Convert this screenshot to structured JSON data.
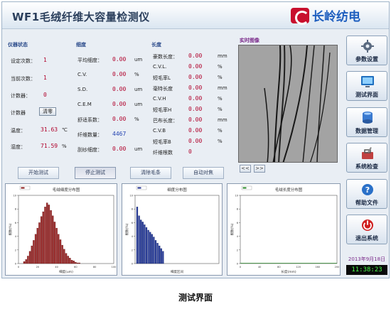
{
  "header": {
    "title": "WF1毛绒纤维大容量检测仪",
    "brand": "长岭纺电"
  },
  "status": {
    "title": "仪器状态",
    "rows": [
      {
        "label": "设定次数：",
        "value": "1"
      },
      {
        "label": "当前次数：",
        "value": "1"
      },
      {
        "label": "计数器：",
        "value": "0"
      },
      {
        "label": "计数器",
        "value": ""
      },
      {
        "label": "温度：",
        "value": "31.63",
        "unit": "℃"
      },
      {
        "label": "湿度：",
        "value": "71.59",
        "unit": "%"
      }
    ],
    "clear_label": "清零"
  },
  "fineness": {
    "title": "细度",
    "rows": [
      {
        "label": "平均细度：",
        "value": "0.00",
        "unit": "um"
      },
      {
        "label": "C.V.",
        "value": "0.00",
        "unit": "%"
      },
      {
        "label": "S.D.",
        "value": "0.00",
        "unit": "um"
      },
      {
        "label": "C.E.M",
        "value": "0.00",
        "unit": "um"
      },
      {
        "label": "舒适系数：",
        "value": "0.00",
        "unit": "%"
      },
      {
        "label": "纤维数量：",
        "value": "4467",
        "unit": ""
      },
      {
        "label": "刮纱细度：",
        "value": "0.00",
        "unit": "um"
      }
    ]
  },
  "length": {
    "title": "长度",
    "rows": [
      {
        "label": "豪数长度：",
        "value": "0.00",
        "unit": "mm"
      },
      {
        "label": "C.V.L.",
        "value": "0.00",
        "unit": "%"
      },
      {
        "label": "短毛率L",
        "value": "0.00",
        "unit": "%"
      },
      {
        "label": "毫特长度",
        "value": "0.00",
        "unit": "mm"
      },
      {
        "label": "C.V.H",
        "value": "0.00",
        "unit": "%"
      },
      {
        "label": "短毛率H",
        "value": "0.00",
        "unit": "%"
      },
      {
        "label": "巴布长度：",
        "value": "0.00",
        "unit": "mm"
      },
      {
        "label": "C.V.B",
        "value": "0.00",
        "unit": "%"
      },
      {
        "label": "短毛率B",
        "value": "0.00",
        "unit": "%"
      },
      {
        "label": "纤维根数",
        "value": "0",
        "unit": ""
      }
    ]
  },
  "image": {
    "title": "实时图像",
    "prev": "<<",
    "next": ">>"
  },
  "actions": [
    "开始测试",
    "停止测试",
    "清除毛条",
    "自动对焦"
  ],
  "charts": {
    "hist_title": "毛绒细度分布图",
    "hist_xlabel": "细度(um)",
    "hist_ylabel": "根数(%)",
    "bar_title": "细度分布图",
    "bar_xlabel": "细度区间",
    "bar_ylabel": "根数(%)",
    "len_title": "毛绒长度分布图",
    "len_xlabel": "长度(mm)",
    "len_ylabel": "根数(%)"
  },
  "chart_data": [
    {
      "type": "bar",
      "title": "毛绒细度分布图",
      "xlabel": "细度(um)",
      "ylabel": "根数(%)",
      "xlim": [
        0,
        100
      ],
      "ylim": [
        0,
        10
      ],
      "x": [
        6,
        8,
        10,
        12,
        14,
        16,
        18,
        20,
        22,
        24,
        26,
        28,
        30,
        32,
        34,
        36,
        38,
        40,
        42,
        44,
        46,
        48,
        50,
        52,
        54,
        56,
        58,
        60,
        62,
        64
      ],
      "values": [
        0.3,
        0.6,
        1.1,
        1.8,
        2.6,
        3.4,
        4.3,
        5.2,
        6.0,
        6.9,
        7.6,
        8.3,
        8.9,
        8.6,
        7.8,
        7.0,
        6.1,
        5.2,
        4.3,
        3.5,
        2.7,
        2.1,
        1.5,
        1.1,
        0.8,
        0.5,
        0.4,
        0.2,
        0.1,
        0.1
      ]
    },
    {
      "type": "bar",
      "title": "细度分布图",
      "xlabel": "细度区间",
      "ylabel": "根数(%)",
      "ylim": [
        0,
        10
      ],
      "values": [
        8.3,
        7.0,
        6.4,
        6.1,
        5.7,
        5.3,
        4.9,
        4.6,
        4.3,
        3.9,
        3.4,
        3.0,
        2.6,
        2.2,
        1.8
      ]
    },
    {
      "type": "line",
      "title": "毛绒长度分布图",
      "xlabel": "长度(mm)",
      "ylabel": "根数(%)",
      "xlim": [
        0,
        200
      ],
      "ylim": [
        0,
        10
      ],
      "values": []
    }
  ],
  "sidebar": {
    "items": [
      {
        "label": "参数设置",
        "icon": "gear-icon"
      },
      {
        "label": "测试界面",
        "icon": "monitor-icon"
      },
      {
        "label": "数据管理",
        "icon": "database-icon"
      },
      {
        "label": "系统检查",
        "icon": "toolbox-icon"
      },
      {
        "label": "帮助文件",
        "icon": "help-icon"
      },
      {
        "label": "退出系统",
        "icon": "power-icon"
      }
    ],
    "date": "2013年9月18日",
    "time": "11:38:23"
  },
  "caption": "测试界面"
}
